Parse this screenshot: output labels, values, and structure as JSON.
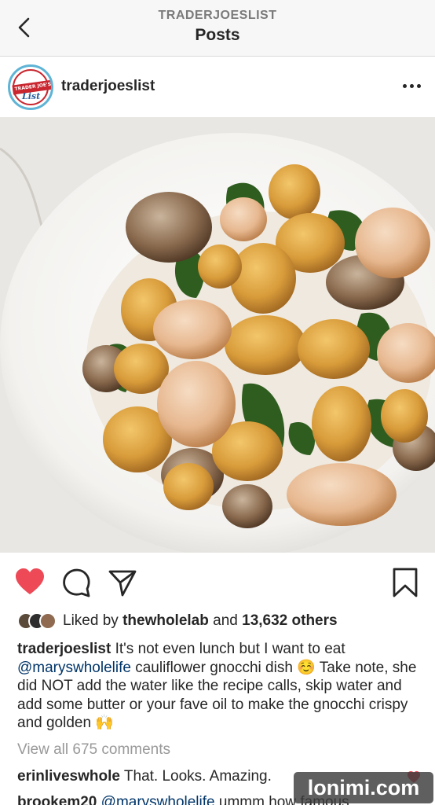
{
  "header": {
    "subtitle": "TRADERJOESLIST",
    "title": "Posts"
  },
  "post": {
    "username": "traderjoeslist",
    "avatar_text": "TRADER JOE'S",
    "avatar_script": "List"
  },
  "likes": {
    "prefix": "Liked by",
    "user": "thewholelab",
    "connector": "and",
    "others": "13,632 others"
  },
  "caption": {
    "username": "traderjoeslist",
    "text1": "It's not even lunch but I want to eat",
    "mention": "@maryswholelife",
    "text2": "cauliflower gnocchi dish",
    "emoji1": "☺️",
    "text3": "Take note, she did NOT add the water like the recipe calls, skip water and add some butter or your fave oil to make the gnocchi crispy and golden",
    "emoji2": "🙌"
  },
  "comments": {
    "view_all": "View all 675 comments",
    "c1_user": "erinliveswhole",
    "c1_text": "That. Looks. Amazing.",
    "c2_user": "brookem20",
    "c2_mention": "@maryswholelife",
    "c2_text": "ummm how famous"
  },
  "watermark": "lonimi.com",
  "colors": {
    "heart": "#ed4956",
    "mention": "#003569",
    "muted": "#999999"
  }
}
